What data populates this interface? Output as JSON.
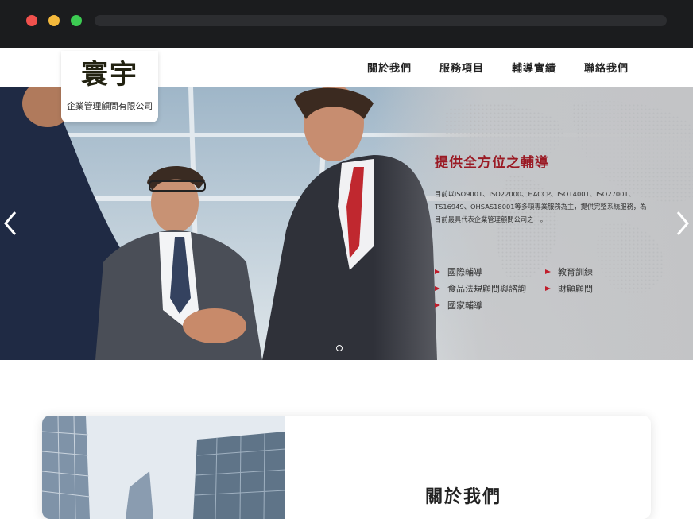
{
  "brand": {
    "name": "寰宇",
    "company": "企業管理顧問有限公司"
  },
  "nav": {
    "items": [
      {
        "label": "關於我們"
      },
      {
        "label": "服務項目"
      },
      {
        "label": "輔導實績"
      },
      {
        "label": "聯絡我們"
      }
    ]
  },
  "hero": {
    "title": "提供全方位之輔導",
    "description": "目前以ISO9001、ISO22000、HACCP、ISO14001、ISO27001、TS16949、OHSAS18001等多項專業服務為主，提供完整系統服務，為目前最具代表企業管理顧問公司之一。",
    "services": [
      {
        "label": "國際輔導"
      },
      {
        "label": "教育訓練"
      },
      {
        "label": "食品法規顧問與諮詢"
      },
      {
        "label": "財顧顧問"
      },
      {
        "label": "國家輔導"
      }
    ],
    "prev_icon": "chevron-left-icon",
    "next_icon": "chevron-right-icon",
    "accent_color": "#9a1a24",
    "bullet_color": "#c01d2b"
  },
  "about": {
    "title": "關於我們"
  }
}
